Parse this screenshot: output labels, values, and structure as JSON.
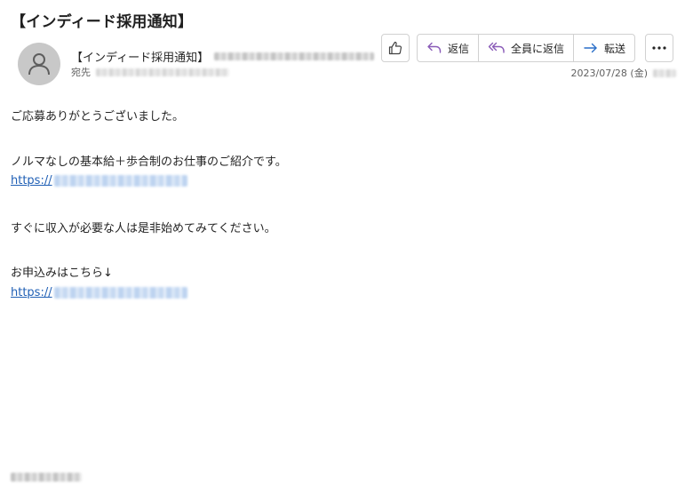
{
  "email": {
    "subject": "【インディード採用通知】",
    "sender_name": "【インディード採用通知】",
    "recipient_label": "宛先",
    "date": "2023/07/28 (金)"
  },
  "toolbar": {
    "reply_label": "返信",
    "reply_all_label": "全員に返信",
    "forward_label": "転送"
  },
  "body": {
    "line1": "ご応募ありがとうございました。",
    "line2": "ノルマなしの基本給＋歩合制のお仕事のご紹介です。",
    "link1_prefix": "https://",
    "line3": "すぐに収入が必要な人は是非始めてみてください。",
    "line4": "お申込みはこちら↓",
    "link2_prefix": "https://"
  },
  "icons": {
    "avatar": "person-icon",
    "like": "thumbs-up-icon",
    "reply": "reply-icon",
    "reply_all": "reply-all-icon",
    "forward": "forward-icon",
    "more": "more-icon"
  },
  "colors": {
    "reply_accent": "#8a5bb8",
    "forward_accent": "#2a6fc9",
    "link": "#1f5fb5",
    "avatar_bg": "#c8c8c8"
  }
}
